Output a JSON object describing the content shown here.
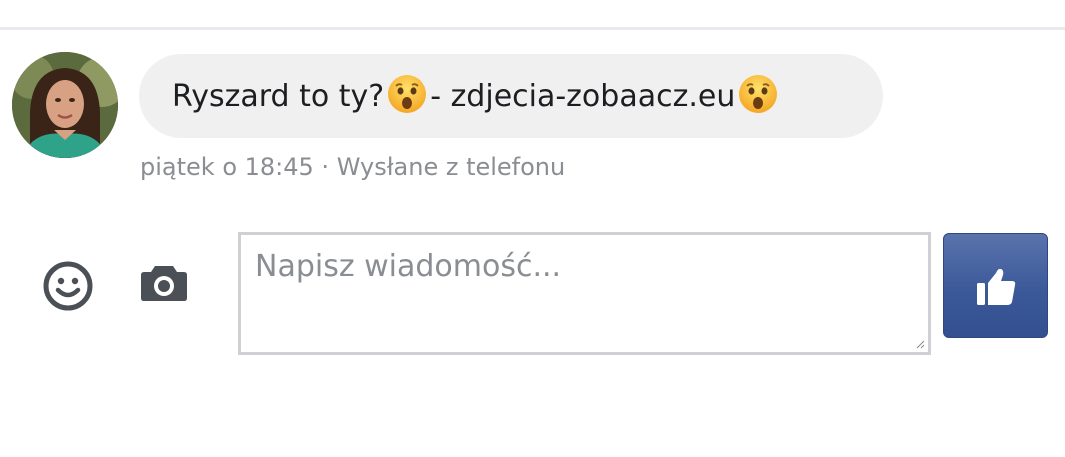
{
  "message": {
    "text_part1": "Ryszard to ty? ",
    "text_part2": " - zdjecia-zobaacz.eu ",
    "emoji_name": "astonished-face-emoji",
    "timestamp": "piątek o 18:45",
    "separator": " · ",
    "sent_from": "Wysłane z telefonu"
  },
  "composer": {
    "placeholder": "Napisz wiadomość..."
  },
  "icons": {
    "emoji_button": "smiley-icon",
    "camera_button": "camera-icon",
    "like_button": "thumbs-up-icon"
  },
  "colors": {
    "like_button": "#3b5998",
    "icon_color": "#4b4f56",
    "bubble_bg": "#f1f0f0",
    "meta_text": "#8a8d91"
  }
}
